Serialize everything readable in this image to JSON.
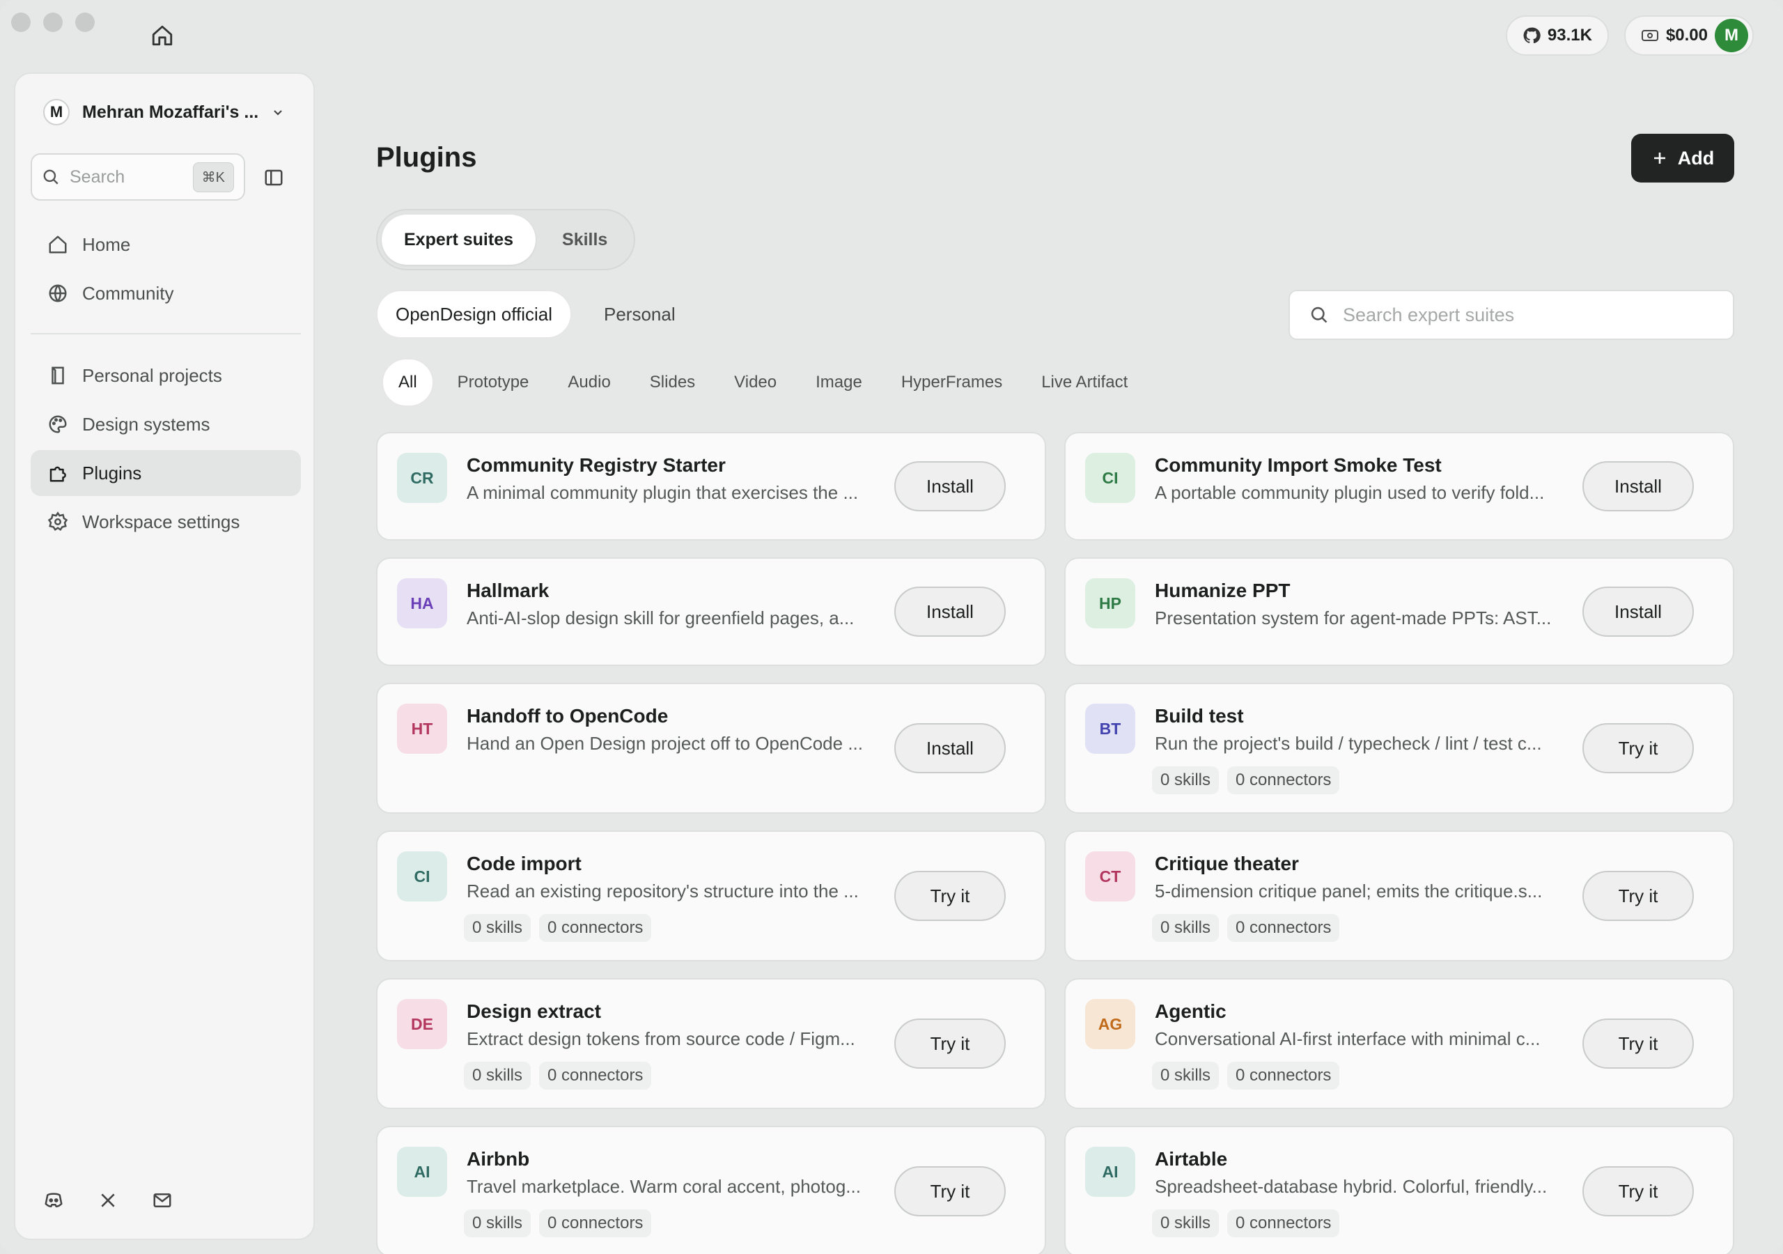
{
  "topbar": {
    "github_stars": "93.1K",
    "credits": "$0.00",
    "user_initial": "M"
  },
  "sidebar": {
    "account_initial": "M",
    "account_name": "Mehran Mozaffari's ...",
    "search_placeholder": "Search",
    "search_shortcut": "⌘K",
    "nav_primary": [
      {
        "label": "Home",
        "icon": "home-icon"
      },
      {
        "label": "Community",
        "icon": "globe-icon"
      }
    ],
    "nav_secondary": [
      {
        "label": "Personal projects",
        "icon": "folder-icon"
      },
      {
        "label": "Design systems",
        "icon": "palette-icon"
      },
      {
        "label": "Plugins",
        "icon": "puzzle-icon",
        "active": true
      },
      {
        "label": "Workspace settings",
        "icon": "gear-icon"
      }
    ],
    "footer_icons": [
      "discord-icon",
      "x-icon",
      "mail-icon"
    ]
  },
  "main": {
    "title": "Plugins",
    "add_label": "Add",
    "segments": [
      "Expert suites",
      "Skills"
    ],
    "subtabs": [
      "OpenDesign official",
      "Personal"
    ],
    "search_placeholder": "Search expert suites",
    "filters": [
      "All",
      "Prototype",
      "Audio",
      "Slides",
      "Video",
      "Image",
      "HyperFrames",
      "Live Artifact"
    ]
  },
  "cards": [
    {
      "abbr": "CR",
      "title": "Community Registry Starter",
      "desc": "A minimal community plugin that exercises the ...",
      "button": "Install",
      "badge_bg": "#dcece9",
      "badge_fg": "#2f6b62"
    },
    {
      "abbr": "CI",
      "title": "Community Import Smoke Test",
      "desc": "A portable community plugin used to verify fold...",
      "button": "Install",
      "badge_bg": "#dcefe1",
      "badge_fg": "#2e7a45"
    },
    {
      "abbr": "HA",
      "title": "Hallmark",
      "desc": "Anti-AI-slop design skill for greenfield pages, a...",
      "button": "Install",
      "badge_bg": "#e7e0f5",
      "badge_fg": "#6a3fb8"
    },
    {
      "abbr": "HP",
      "title": "Humanize PPT",
      "desc": "Presentation system for agent-made PPTs: AST...",
      "button": "Install",
      "badge_bg": "#dcefe1",
      "badge_fg": "#2e7a45"
    },
    {
      "abbr": "HT",
      "title": "Handoff to OpenCode",
      "desc": "Hand an Open Design project off to OpenCode ...",
      "button": "Install",
      "badge_bg": "#f6dde6",
      "badge_fg": "#b3365f"
    },
    {
      "abbr": "BT",
      "title": "Build test",
      "desc": "Run the project's build / typecheck / lint / test c...",
      "button": "Try it",
      "skills": "0 skills",
      "connectors": "0 connectors",
      "badge_bg": "#e1e1f6",
      "badge_fg": "#4343b0"
    },
    {
      "abbr": "CI",
      "title": "Code import",
      "desc": "Read an existing repository's structure into the ...",
      "button": "Try it",
      "skills": "0 skills",
      "connectors": "0 connectors",
      "badge_bg": "#dcece9",
      "badge_fg": "#2f6b62"
    },
    {
      "abbr": "CT",
      "title": "Critique theater",
      "desc": "5-dimension critique panel; emits the critique.s...",
      "button": "Try it",
      "skills": "0 skills",
      "connectors": "0 connectors",
      "badge_bg": "#f6dde6",
      "badge_fg": "#b3365f"
    },
    {
      "abbr": "DE",
      "title": "Design extract",
      "desc": "Extract design tokens from source code / Figm...",
      "button": "Try it",
      "skills": "0 skills",
      "connectors": "0 connectors",
      "badge_bg": "#f6dde6",
      "badge_fg": "#b3365f"
    },
    {
      "abbr": "AG",
      "title": "Agentic",
      "desc": "Conversational AI-first interface with minimal c...",
      "button": "Try it",
      "skills": "0 skills",
      "connectors": "0 connectors",
      "badge_bg": "#f8e6d4",
      "badge_fg": "#c06a1a"
    },
    {
      "abbr": "AI",
      "title": "Airbnb",
      "desc": "Travel marketplace. Warm coral accent, photog...",
      "button": "Try it",
      "skills": "0 skills",
      "connectors": "0 connectors",
      "badge_bg": "#dcece9",
      "badge_fg": "#2f6b62"
    },
    {
      "abbr": "AI",
      "title": "Airtable",
      "desc": "Spreadsheet-database hybrid. Colorful, friendly...",
      "button": "Try it",
      "skills": "0 skills",
      "connectors": "0 connectors",
      "badge_bg": "#dcece9",
      "badge_fg": "#2f6b62"
    }
  ]
}
